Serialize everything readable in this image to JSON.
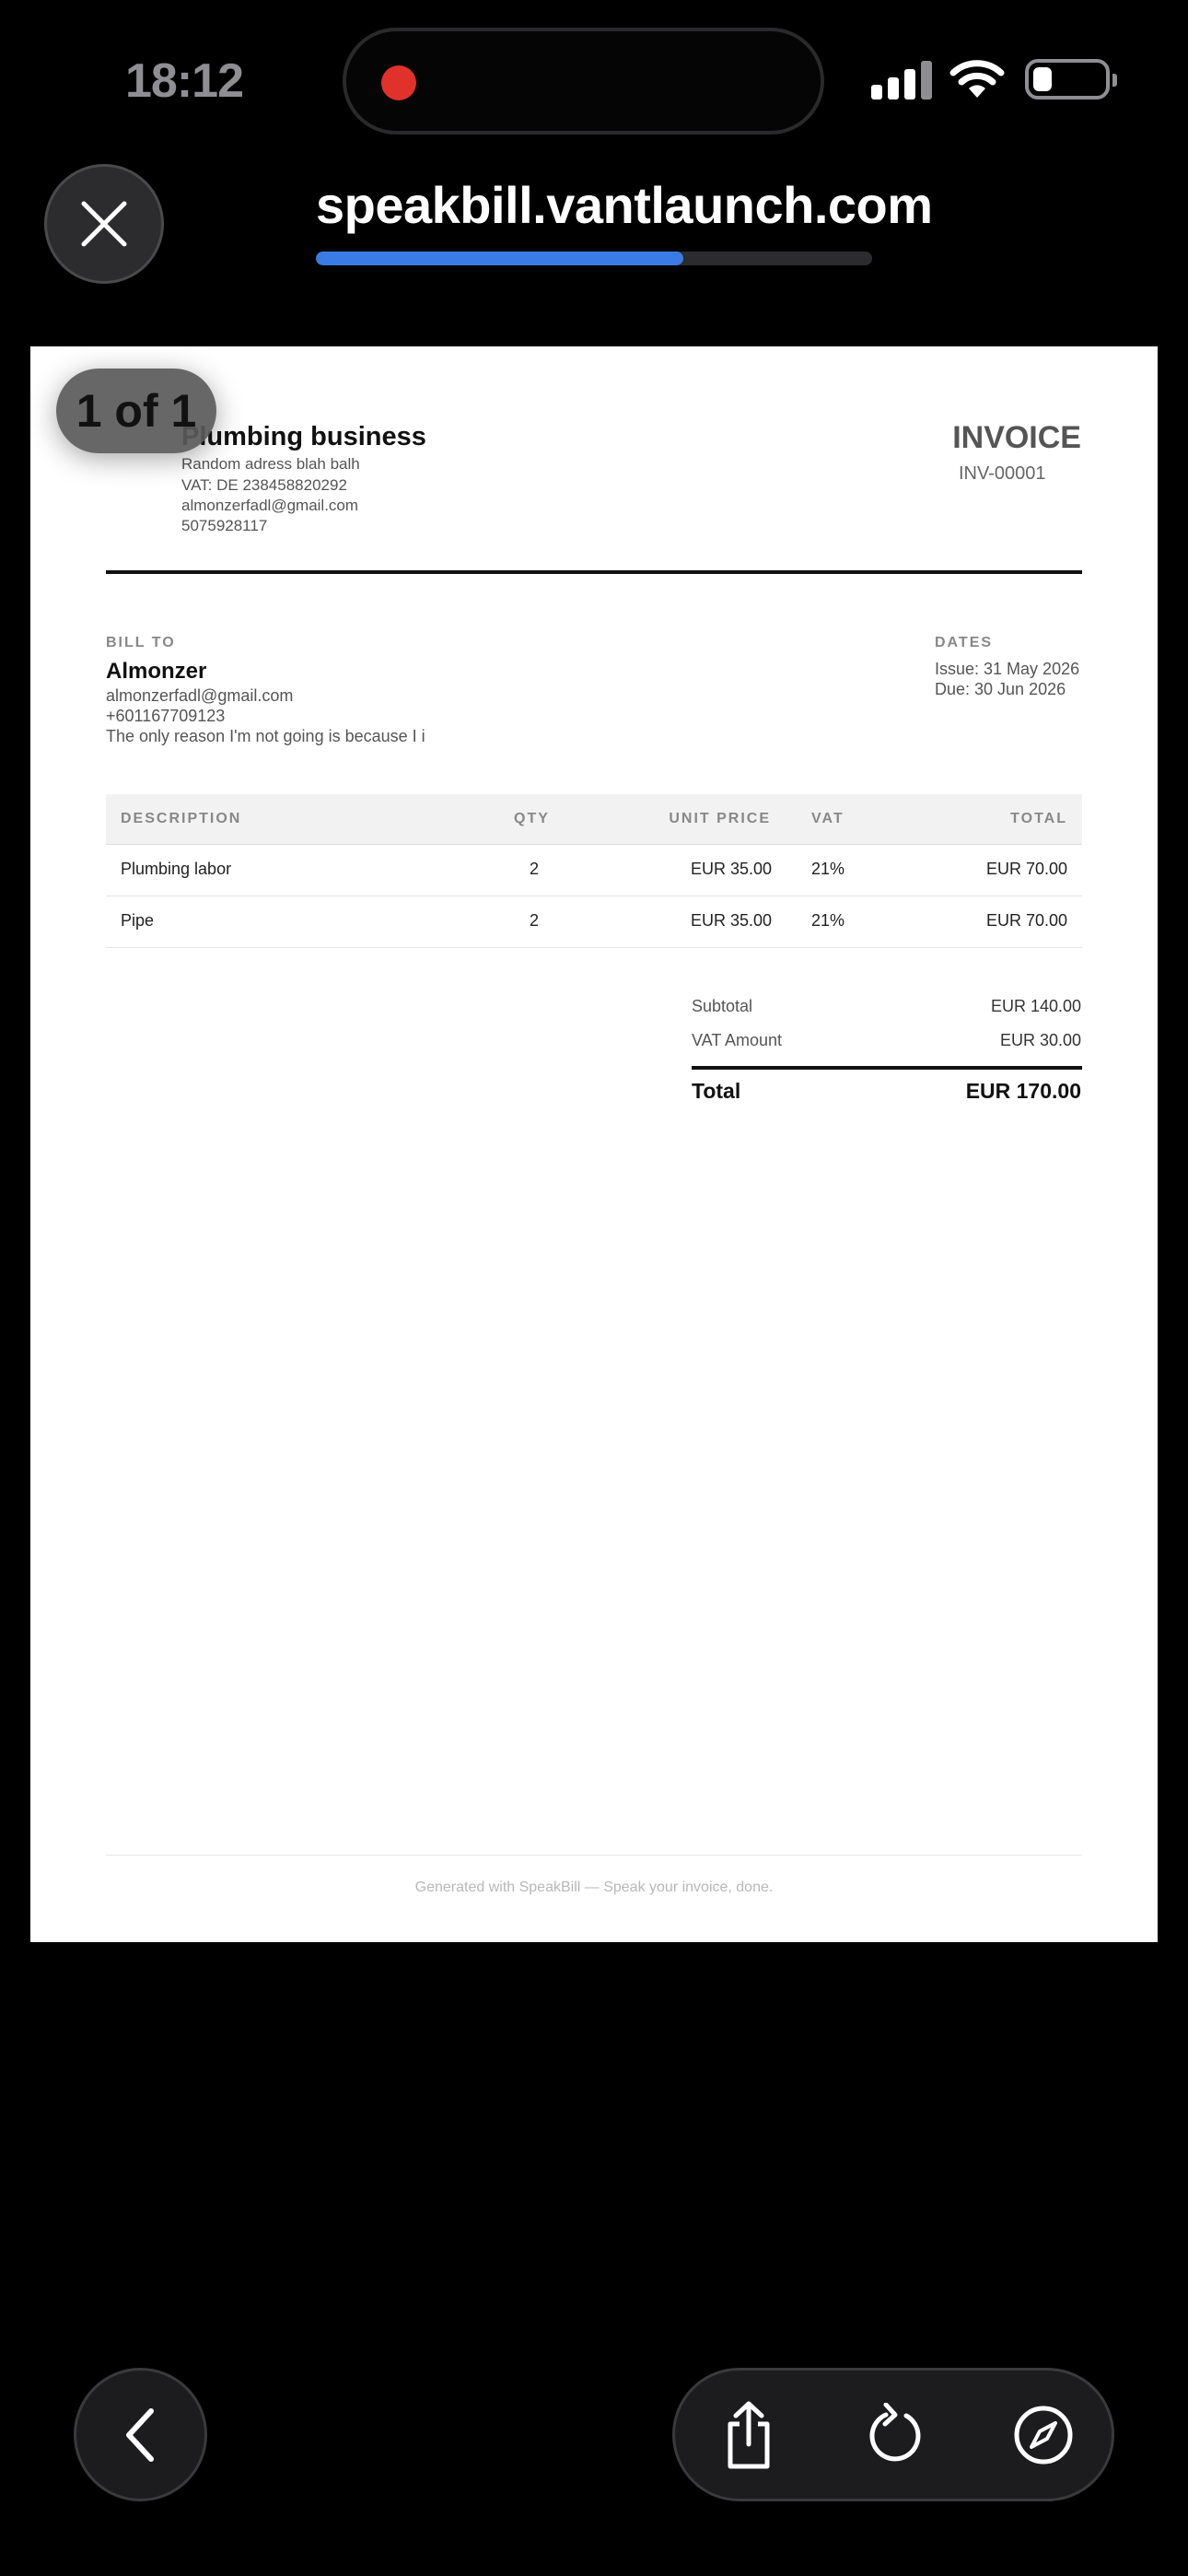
{
  "status_bar": {
    "time": "18:12"
  },
  "browser": {
    "url": "speakbill.vantlaunch.com",
    "load_progress_percent": 66,
    "page_indicator": "1 of 1"
  },
  "invoice": {
    "business": {
      "name": "Plumbing business",
      "address": "Random adress blah balh",
      "vat": "VAT: DE 238458820292",
      "email": "almonzerfadl@gmail.com",
      "phone": "5075928117"
    },
    "title": "INVOICE",
    "number": "INV-00001",
    "bill_to": {
      "label": "BILL TO",
      "name": "Almonzer",
      "email": "almonzerfadl@gmail.com",
      "phone": "+601167709123",
      "note": "The only reason I'm not going is because I i"
    },
    "dates": {
      "label": "DATES",
      "issue": "Issue: 31 May 2026",
      "due": "Due: 30 Jun 2026"
    },
    "table": {
      "headers": [
        "DESCRIPTION",
        "QTY",
        "UNIT PRICE",
        "VAT",
        "TOTAL"
      ],
      "rows": [
        [
          "Plumbing labor",
          "2",
          "EUR 35.00",
          "21%",
          "EUR 70.00"
        ],
        [
          "Pipe",
          "2",
          "EUR 35.00",
          "21%",
          "EUR 70.00"
        ]
      ]
    },
    "totals": {
      "subtotal_label": "Subtotal",
      "subtotal": "EUR 140.00",
      "vat_label": "VAT Amount",
      "vat": "EUR 30.00",
      "total_label": "Total",
      "total": "EUR 170.00"
    },
    "footer": "Generated with SpeakBill — Speak your invoice, done."
  },
  "icons": {
    "close": "close-icon",
    "back": "chevron-left-icon",
    "share": "share-icon",
    "reload": "reload-icon",
    "safari": "compass-icon"
  },
  "colors": {
    "progress": "#3b7be6",
    "record": "#e0312b"
  }
}
